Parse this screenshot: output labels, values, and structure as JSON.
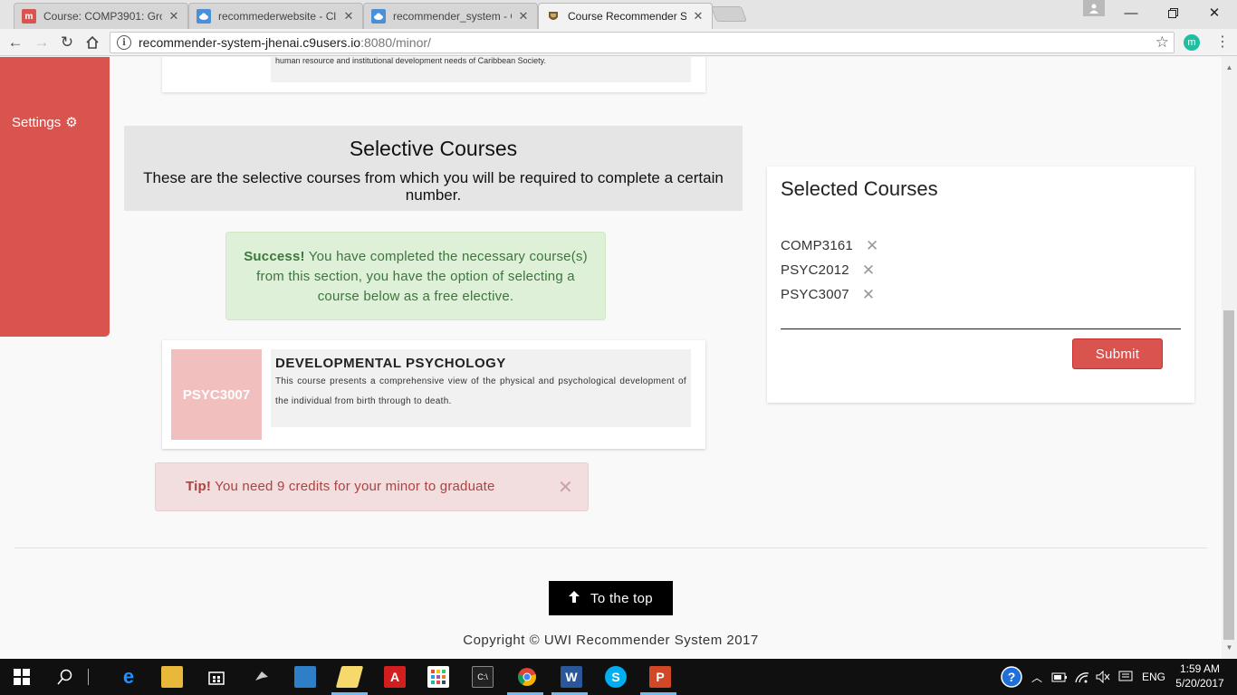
{
  "browser": {
    "tabs": [
      {
        "title": "Course: COMP3901: Grou",
        "favicon": "moodle-icon",
        "color": "#d9534f"
      },
      {
        "title": "recommederwebsite - Cl",
        "favicon": "cloud9-icon",
        "color": "#4a8fd8"
      },
      {
        "title": "recommender_system - C",
        "favicon": "cloud9-icon",
        "color": "#4a8fd8"
      },
      {
        "title": "Course Recommender Sy",
        "favicon": "uwi-crest-icon",
        "color": "#7a5a2a"
      }
    ],
    "url_host": "recommender-system-jhenai.c9users.io",
    "url_path": ":8080/minor/",
    "extension_letter": "m"
  },
  "sidebar": {
    "settings_label": "Settings"
  },
  "top_card": {
    "desc_fragment": "human resource and institutional development needs of Caribbean Society."
  },
  "section": {
    "title": "Selective Courses",
    "subtitle": "These are the selective courses from which you will be required to complete a certain number."
  },
  "success_alert": {
    "strong": "Success!",
    "text": " You have completed the necessary course(s) from this section, you have the option of selecting a course below as a free elective."
  },
  "course_card": {
    "code": "PSYC3007",
    "name": "DEVELOPMENTAL PSYCHOLOGY",
    "description": "This course presents a comprehensive view of the physical and psychological development of the individual from birth through to death."
  },
  "tip_alert": {
    "strong": "Tip!",
    "text": " You need 9 credits for your minor to graduate"
  },
  "selected_panel": {
    "title": "Selected Courses",
    "items": [
      "COMP3161",
      "PSYC2012",
      "PSYC3007"
    ],
    "submit_label": "Submit"
  },
  "footer": {
    "top_button": "To the top",
    "copyright": "Copyright © UWI Recommender System 2017"
  },
  "taskbar": {
    "language": "ENG",
    "time": "1:59 AM",
    "date": "5/20/2017"
  },
  "colors": {
    "accent": "#d9534f",
    "success_bg": "#dff0d8",
    "danger_bg": "#f2dede"
  }
}
